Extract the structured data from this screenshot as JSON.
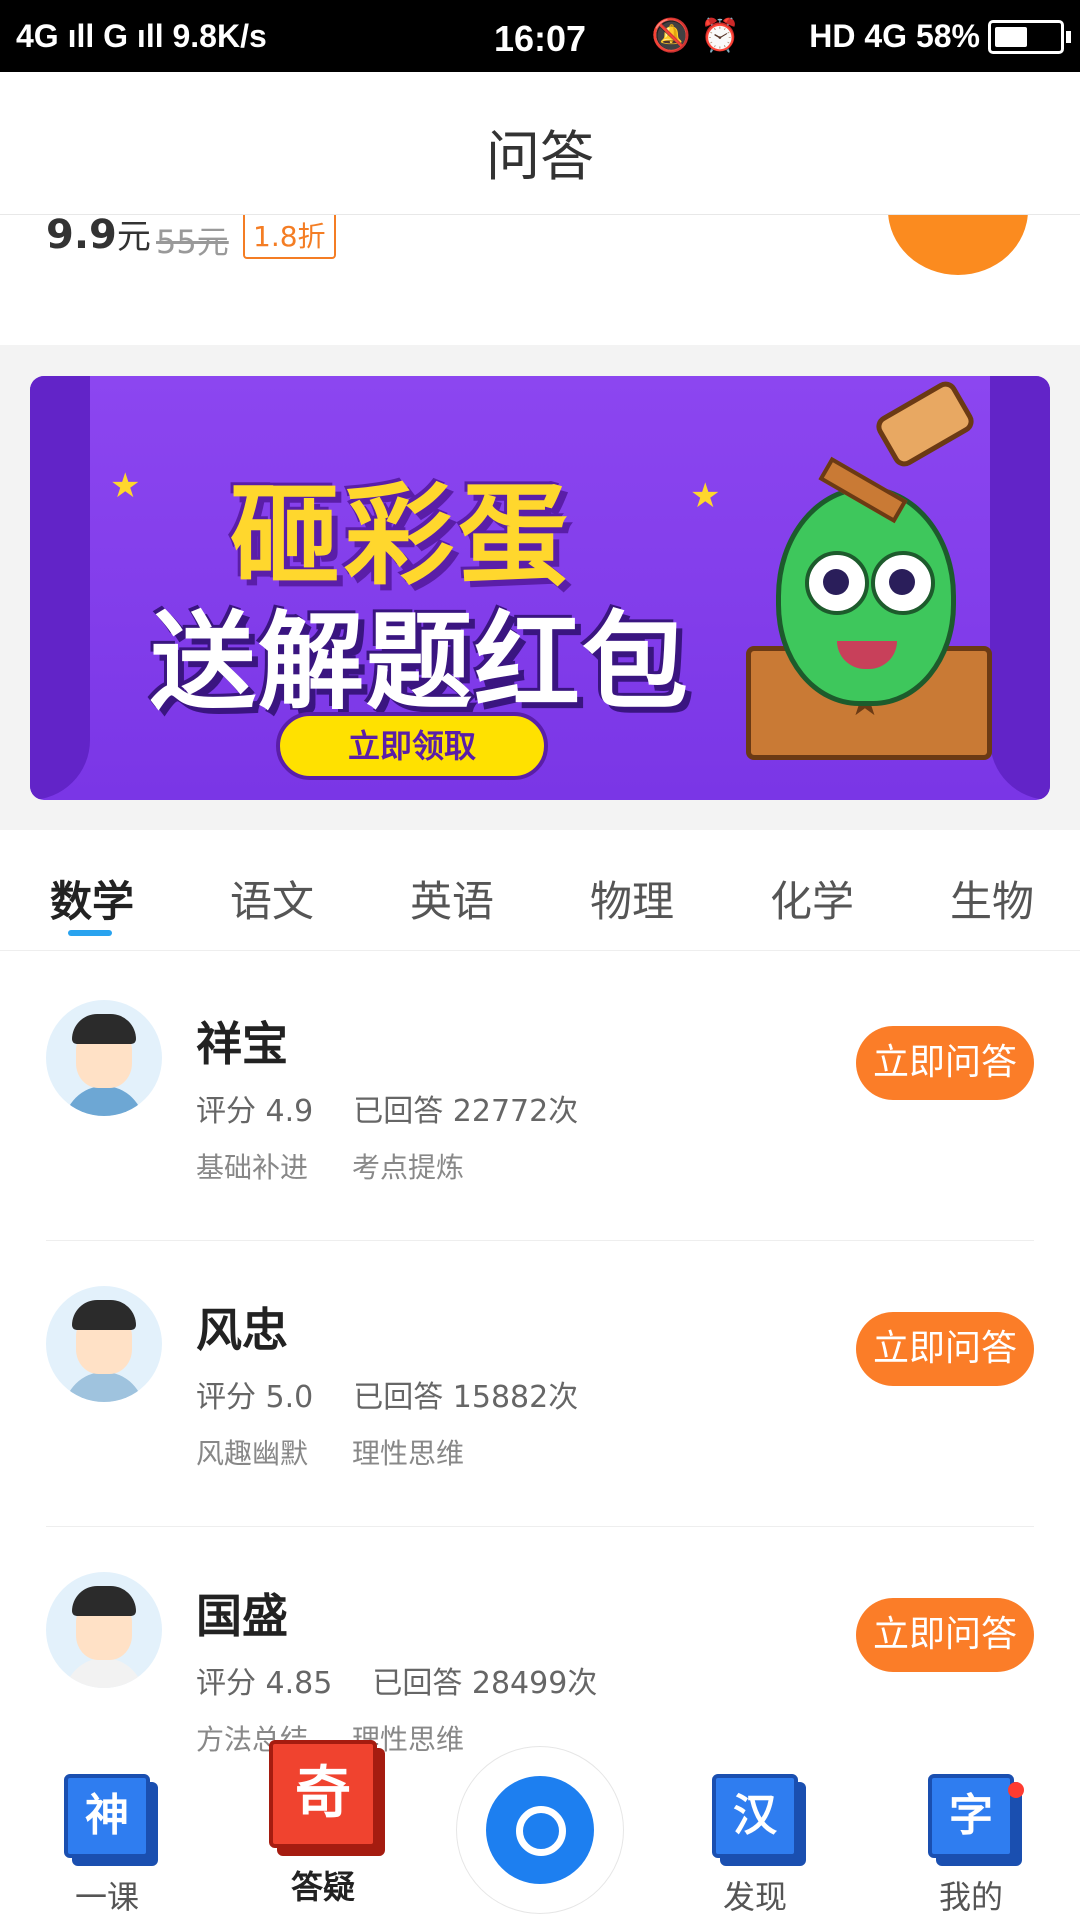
{
  "status_bar": {
    "left": "4G ıll G ıll 9.8K/s",
    "time": "16:07",
    "right": "HD 4G 58%",
    "battery_percent": 58
  },
  "header": {
    "title": "问答"
  },
  "promo": {
    "price": "9.9",
    "price_unit": "元",
    "original_price": "55元",
    "discount": "1.8折"
  },
  "banner": {
    "line1": "砸彩蛋",
    "line2": "送解题红包",
    "cta": "立即领取"
  },
  "tabs": [
    {
      "label": "数学",
      "active": true
    },
    {
      "label": "语文"
    },
    {
      "label": "英语"
    },
    {
      "label": "物理"
    },
    {
      "label": "化学"
    },
    {
      "label": "生物"
    }
  ],
  "teachers": [
    {
      "name": "祥宝",
      "rating": "评分 4.9",
      "answered": "已回答 22772次",
      "tags": [
        "基础补进",
        "考点提炼"
      ],
      "button": "立即问答"
    },
    {
      "name": "风忠",
      "rating": "评分 5.0",
      "answered": "已回答 15882次",
      "tags": [
        "风趣幽默",
        "理性思维"
      ],
      "button": "立即问答"
    },
    {
      "name": "国盛",
      "rating": "评分 4.85",
      "answered": "已回答 28499次",
      "tags": [
        "方法总结",
        "理性思维"
      ],
      "button": "立即问答"
    }
  ],
  "bottom_nav": [
    {
      "icon_char": "神",
      "label": "一课",
      "icon": "cube-icon"
    },
    {
      "icon_char": "奇",
      "label": "答疑",
      "icon": "cube-icon",
      "active": true
    },
    {
      "label": "",
      "icon": "camera-icon"
    },
    {
      "icon_char": "汉",
      "label": "发现",
      "icon": "cube-icon"
    },
    {
      "icon_char": "字",
      "label": "我的",
      "icon": "cube-icon",
      "badge": true
    }
  ],
  "colors": {
    "accent_orange": "#fb7d28",
    "tab_underline": "#29a3ef",
    "banner_purple": "#8c46f0",
    "camera_blue": "#1d7ff0"
  }
}
